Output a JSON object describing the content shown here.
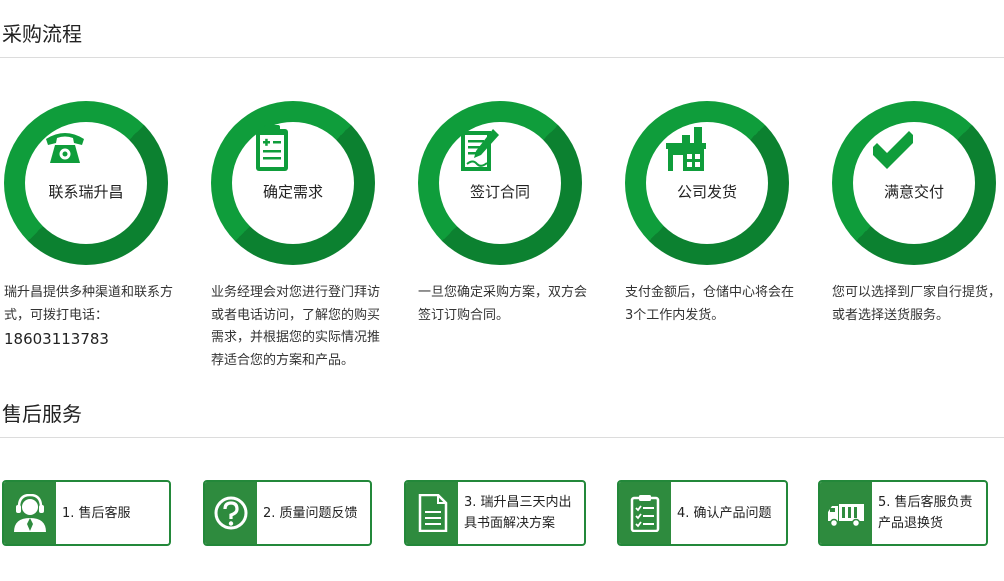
{
  "purchase": {
    "title": "采购流程",
    "steps": [
      {
        "icon": "telephone-icon",
        "label": "联系瑞升昌",
        "desc": "瑞升昌提供多种渠道和联系方式，可拨打电话：",
        "phone": "18603113783"
      },
      {
        "icon": "clipboard-icon",
        "label": "确定需求",
        "desc": "业务经理会对您进行登门拜访或者电话访问，了解您的购买需求，并根据您的实际情况推荐适合您的方案和产品。"
      },
      {
        "icon": "contract-signing-icon",
        "label": "签订合同",
        "desc": "一旦您确定采购方案，双方会签订订购合同。"
      },
      {
        "icon": "warehouse-icon",
        "label": "公司发货",
        "desc": "支付金额后，仓储中心将会在3个工作内发货。"
      },
      {
        "icon": "checkmark-icon",
        "label": "满意交付",
        "desc": "您可以选择到厂家自行提货，或者选择送货服务。"
      }
    ]
  },
  "aftersales": {
    "title": "售后服务",
    "items": [
      {
        "icon": "customer-service-icon",
        "label": "1. 售后客服"
      },
      {
        "icon": "question-icon",
        "label": "2. 质量问题反馈"
      },
      {
        "icon": "document-icon",
        "label": "3. 瑞升昌三天内出具书面解决方案"
      },
      {
        "icon": "checklist-icon",
        "label": "4. 确认产品问题"
      },
      {
        "icon": "truck-icon",
        "label": "5. 售后客服负责产品退换货"
      }
    ]
  },
  "colors": {
    "brand_green": "#0f9d3b",
    "box_green": "#2e8b3e",
    "rule": "#dcdcdc"
  }
}
